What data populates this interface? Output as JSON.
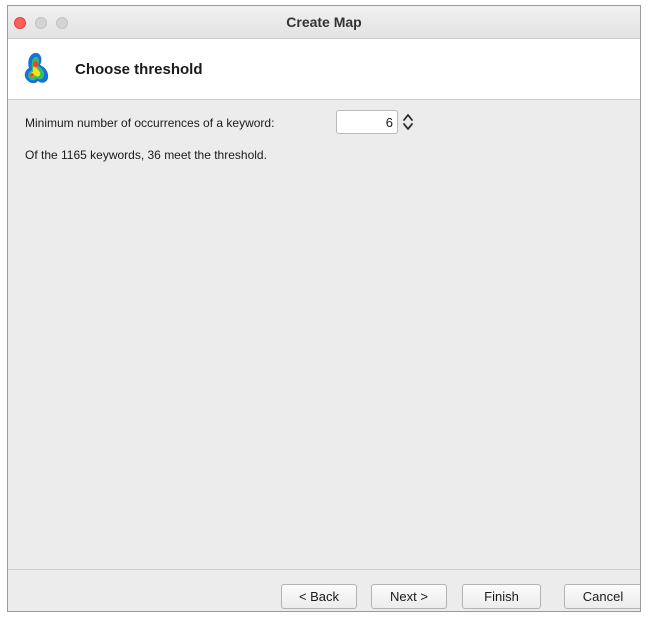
{
  "window": {
    "title": "Create Map"
  },
  "header": {
    "title": "Choose threshold",
    "icon": "density-map-icon"
  },
  "threshold": {
    "label": "Minimum number of occurrences of a keyword:",
    "value": "6",
    "result": "Of the 1165 keywords, 36 meet the threshold."
  },
  "buttons": {
    "back": "< Back",
    "next": "Next >",
    "finish": "Finish",
    "cancel": "Cancel"
  },
  "colors": {
    "close_button": "#fe5f57"
  }
}
